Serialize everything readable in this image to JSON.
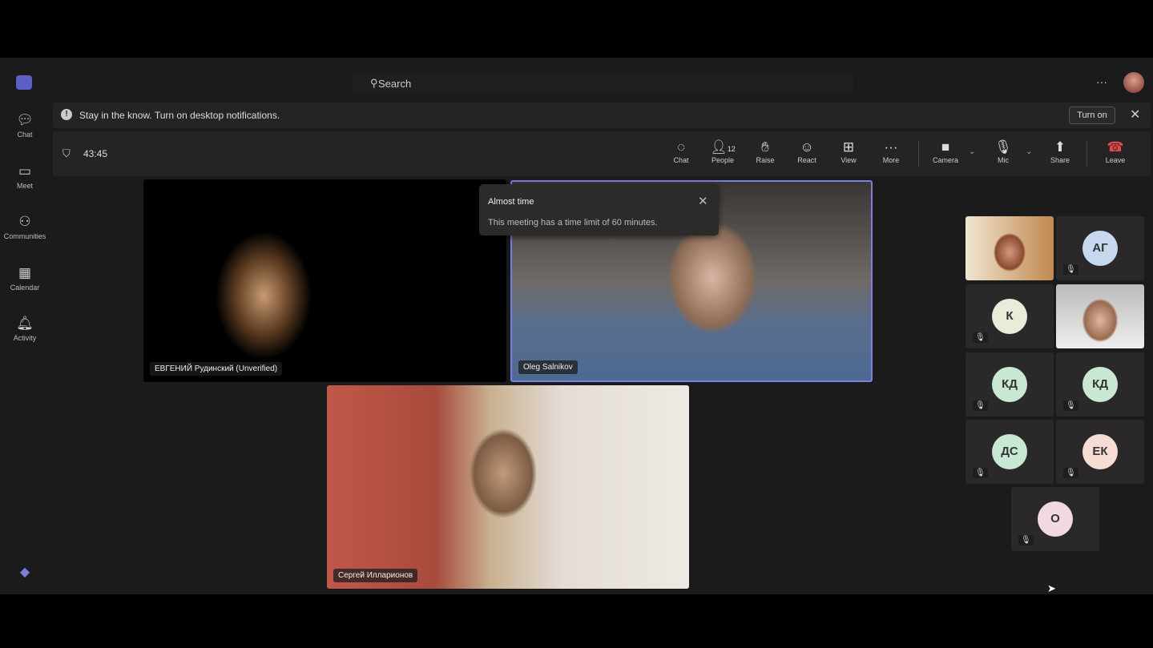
{
  "sidebar": {
    "items": [
      {
        "label": "Chat",
        "icon": "chat-icon"
      },
      {
        "label": "Meet",
        "icon": "video-icon"
      },
      {
        "label": "Communities",
        "icon": "communities-icon"
      },
      {
        "label": "Calendar",
        "icon": "calendar-icon"
      },
      {
        "label": "Activity",
        "icon": "bell-icon"
      }
    ]
  },
  "search": {
    "placeholder": "Search"
  },
  "notification": {
    "message": "Stay in the know. Turn on desktop notifications.",
    "button": "Turn on"
  },
  "meeting": {
    "timer": "43:45",
    "people_count": "12",
    "toolbar": {
      "chat": "Chat",
      "people": "People",
      "raise": "Raise",
      "react": "React",
      "view": "View",
      "more": "More",
      "camera": "Camera",
      "mic": "Mic",
      "share": "Share",
      "leave": "Leave"
    }
  },
  "toast": {
    "title": "Almost time",
    "body": "This meeting has a time limit of 60 minutes."
  },
  "participants": {
    "main": [
      "ЕВГЕНИЙ Рудинский (Unverified)",
      "Oleg Salnikov",
      "Сергей Илларионов"
    ],
    "gallery": [
      "АГ",
      "К",
      "КД",
      "КД",
      "ДС",
      "ЕК",
      "О"
    ]
  },
  "colors": {
    "accent": "#7b7fe0",
    "leave": "#e5484d"
  }
}
